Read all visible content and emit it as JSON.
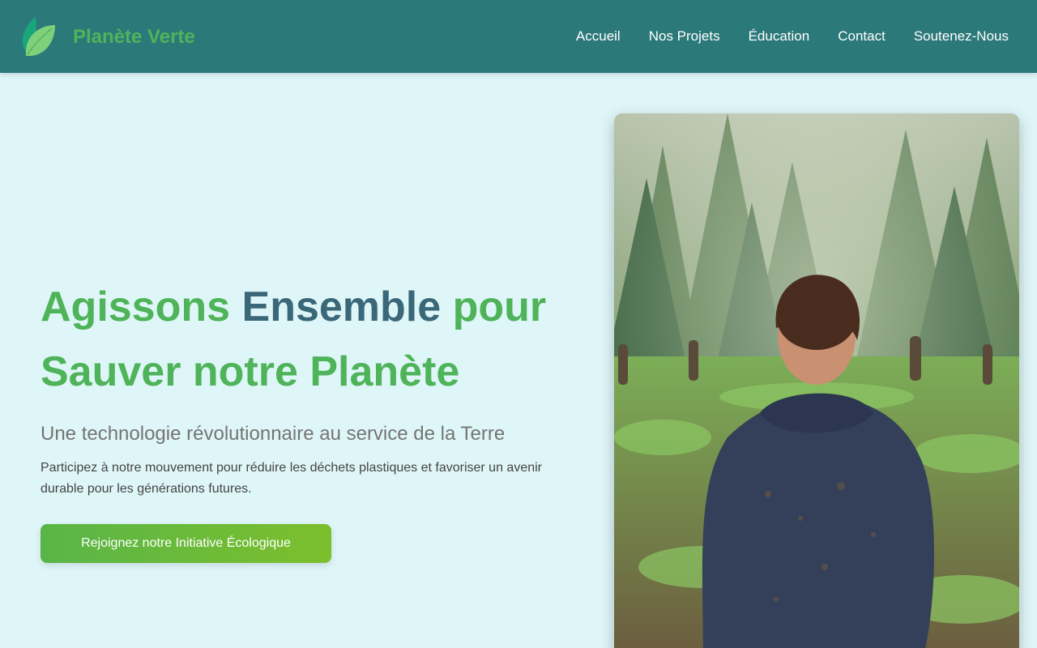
{
  "brand": {
    "name": "Planète Verte",
    "logo_icon": "leaf-icon"
  },
  "nav": {
    "items": [
      "Accueil",
      "Nos Projets",
      "Éducation",
      "Contact",
      "Soutenez-Nous"
    ]
  },
  "hero": {
    "title_part1": "Agissons",
    "title_part2": "Ensemble",
    "title_part3": "pour Sauver notre Planète",
    "subtitle": "Une technologie révolutionnaire au service de la Terre",
    "description": "Participez à notre mouvement pour réduire les déchets plastiques et favoriser un avenir durable pour les générations futures.",
    "cta_label": "Rejoignez notre Initiative Écologique"
  },
  "image": {
    "subject": "person-in-hoodie-forest-planting-photo"
  },
  "colors": {
    "header_bg": "#2c797a",
    "page_bg": "#dff6f8",
    "accent_green": "#4fb35a",
    "title_dark": "#3a6879"
  }
}
